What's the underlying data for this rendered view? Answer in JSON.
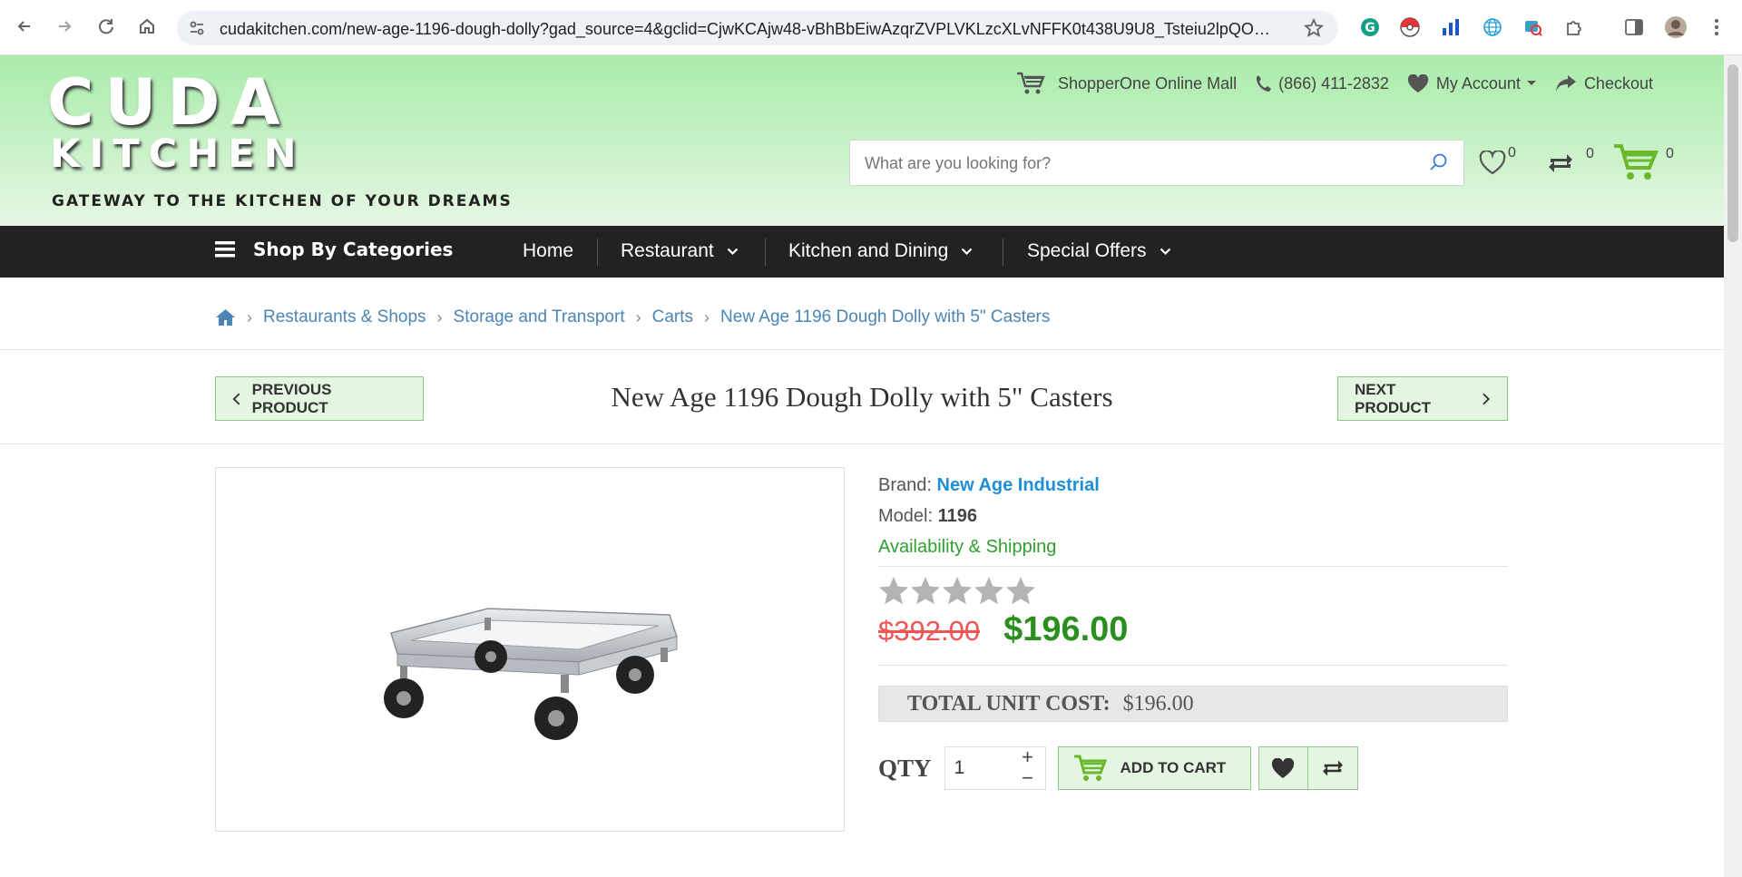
{
  "browser": {
    "url": "cudakitchen.com/new-age-1196-dough-dolly?gad_source=4&gclid=CjwKCAjw48-vBhBbEiwAzqrZVPLVKLzcXLvNFFK0t438U9U8_Tsteiu2lpQOw19Q7kzi_T..."
  },
  "header": {
    "logo_line1": "CUDA",
    "logo_line2": "KITCHEN",
    "tagline": "GATEWAY TO THE KITCHEN OF YOUR DREAMS",
    "mall_link": "ShopperOne Online Mall",
    "phone": "(866) 411-2832",
    "account": "My Account",
    "checkout": "Checkout",
    "search_placeholder": "What are you looking for?",
    "wishlist_count": "0",
    "compare_count": "0",
    "cart_count": "0"
  },
  "nav": {
    "categories": "Shop By Categories",
    "items": [
      "Home",
      "Restaurant",
      "Kitchen and Dining",
      "Special Offers"
    ]
  },
  "breadcrumb": [
    "Restaurants & Shops",
    "Storage and Transport",
    "Carts",
    "New Age 1196 Dough Dolly with 5\" Casters"
  ],
  "product": {
    "prev_label": "PREVIOUS PRODUCT",
    "next_label": "NEXT PRODUCT",
    "title": "New Age 1196 Dough Dolly with 5\" Casters",
    "brand_label": "Brand:",
    "brand": "New Age Industrial",
    "model_label": "Model:",
    "model": "1196",
    "availability": "Availability & Shipping",
    "rating": 0,
    "old_price": "$392.00",
    "price": "$196.00",
    "total_label": "TOTAL UNIT COST:",
    "total_value": "$196.00",
    "qty_label": "QTY",
    "qty": "1",
    "add_to_cart": "ADD TO CART"
  },
  "colors": {
    "header_green": "#a9ecaa",
    "button_bg": "#e4f6e1",
    "price_green": "#2a8f1e",
    "old_price_red": "#e55555",
    "link_blue": "#1d8fd8"
  }
}
